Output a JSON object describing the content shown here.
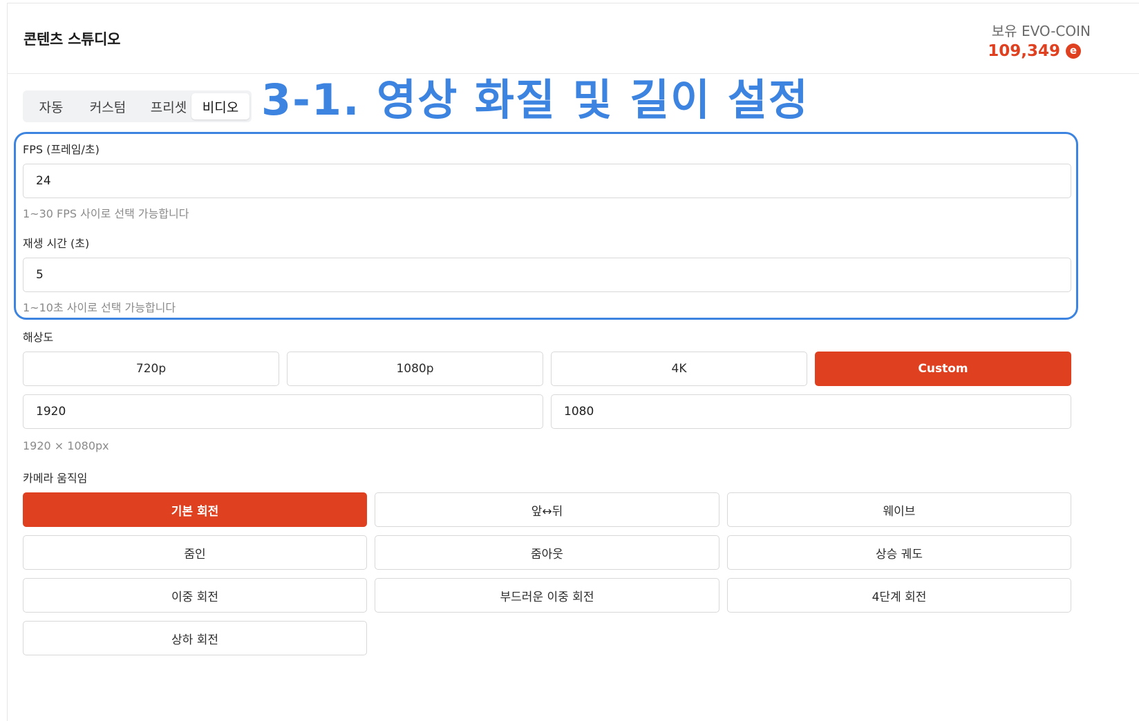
{
  "header": {
    "title": "콘텐츠 스튜디오",
    "coin_label": "보유 EVO-COIN",
    "coin_value": "109,349",
    "coin_icon": "e"
  },
  "tabs": [
    {
      "label": "자동",
      "active": false
    },
    {
      "label": "커스텀",
      "active": false
    },
    {
      "label": "프리셋",
      "active": false
    },
    {
      "label": "비디오",
      "active": true
    }
  ],
  "overlay_title": "3-1. 영상 화질 및 길이 설정",
  "fps": {
    "label": "FPS (프레임/초)",
    "value": "24",
    "hint": "1~30 FPS 사이로 선택 가능합니다"
  },
  "duration": {
    "label": "재생 시간 (초)",
    "value": "5",
    "hint": "1~10초 사이로 선택 가능합니다"
  },
  "resolution": {
    "label": "해상도",
    "options": [
      "720p",
      "1080p",
      "4K",
      "Custom"
    ],
    "selected": "Custom",
    "width_value": "1920",
    "height_value": "1080",
    "summary": "1920 × 1080px"
  },
  "camera": {
    "label": "카메라 움직임",
    "options": [
      "기본 회전",
      "앞↔뒤",
      "웨이브",
      "줌인",
      "줌아웃",
      "상승 궤도",
      "이중 회전",
      "부드러운 이중 회전",
      "4단계 회전",
      "상하 회전"
    ],
    "selected": "기본 회전"
  },
  "colors": {
    "accent": "#df4120",
    "highlight": "#3d84e0"
  }
}
